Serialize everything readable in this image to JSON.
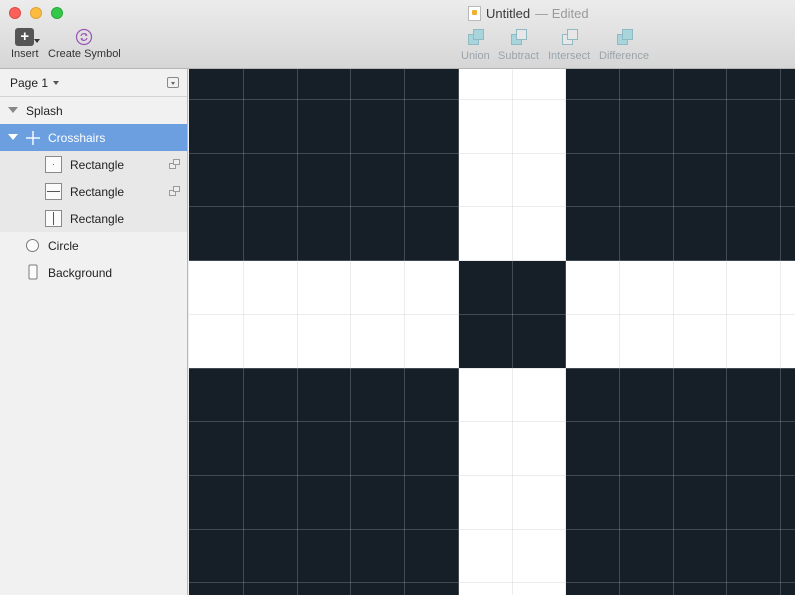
{
  "window": {
    "title": "Untitled",
    "edited": "— Edited"
  },
  "toolbar": {
    "insert_label": "Insert",
    "create_symbol_label": "Create Symbol",
    "union_label": "Union",
    "subtract_label": "Subtract",
    "intersect_label": "Intersect",
    "difference_label": "Difference"
  },
  "sidebar": {
    "page_label": "Page 1",
    "layers": [
      {
        "label": "Splash"
      },
      {
        "label": "Crosshairs"
      },
      {
        "label": "Rectangle"
      },
      {
        "label": "Rectangle"
      },
      {
        "label": "Rectangle"
      },
      {
        "label": "Circle"
      },
      {
        "label": "Background"
      }
    ]
  },
  "colors": {
    "canvas_dark": "#161e28",
    "crosshair": "#ffffff",
    "selection": "#6b9fe0"
  }
}
